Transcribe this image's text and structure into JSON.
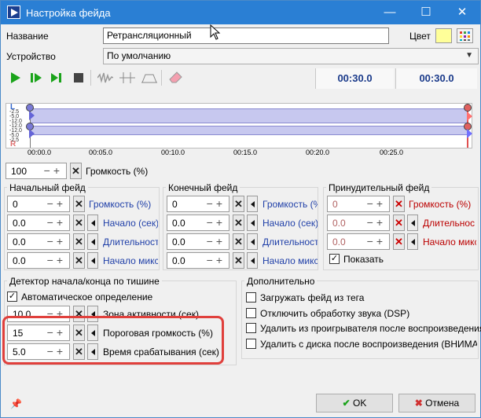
{
  "window": {
    "title": "Настройка фейда",
    "minimize": "—",
    "maximize": "☐",
    "close": "✕"
  },
  "name_label": "Название",
  "name_value": "Ретрансляционный",
  "color_label": "Цвет",
  "device_label": "Устройство",
  "device_value": "По умолчанию",
  "toolbar": {
    "icons": [
      "play-icon",
      "play-segment-icon",
      "play-to-end-icon",
      "stop-icon",
      "waveform-icon",
      "markers-icon",
      "envelope-icon",
      "eraser-icon"
    ],
    "time1": "00:30.0",
    "time2": "00:30.0"
  },
  "waveform": {
    "channel_left": "L",
    "channel_right": "R",
    "db_top": [
      "-2.5",
      "-5.0",
      "-12.0",
      "-12.0"
    ],
    "db_bottom": [
      "-12.0",
      "-5.0",
      "-2.5"
    ],
    "ruler": [
      "00:00.0",
      "00:05.0",
      "00:10.0",
      "00:15.0",
      "00:20.0",
      "00:25.0"
    ]
  },
  "volume": {
    "value": "100",
    "label": "Громкость (%)"
  },
  "fade_in": {
    "title": "Начальный фейд",
    "rows": [
      {
        "value": "0",
        "label": "Громкость (%)"
      },
      {
        "value": "0.0",
        "label": "Начало (сек)"
      },
      {
        "value": "0.0",
        "label": "Длительност"
      },
      {
        "value": "0.0",
        "label": "Начало микса"
      }
    ]
  },
  "fade_out": {
    "title": "Конечный фейд",
    "rows": [
      {
        "value": "0",
        "label": "Громкость (%)"
      },
      {
        "value": "0.0",
        "label": "Начало (сек)"
      },
      {
        "value": "0.0",
        "label": "Длительност"
      },
      {
        "value": "0.0",
        "label": "Начало микса"
      }
    ]
  },
  "forced_fade": {
    "title": "Принудительный фейд",
    "rows": [
      {
        "value": "0",
        "label": "Громкость (%)"
      },
      {
        "value": "0.0",
        "label": "Длительнос"
      },
      {
        "value": "0.0",
        "label": "Начало микса"
      }
    ],
    "show_label": "Показать"
  },
  "silence": {
    "title": "Детектор начала/конца по тишине",
    "auto_label": "Автоматическое определение",
    "rows": [
      {
        "value": "10.0",
        "label": "Зона активности (сек)"
      },
      {
        "value": "15",
        "label": "Пороговая громкость (%)"
      },
      {
        "value": "5.0",
        "label": "Время срабатывания (сек)"
      }
    ]
  },
  "extra": {
    "title": "Дополнительно",
    "options": [
      "Загружать фейд из тега",
      "Отключить обработку звука (DSP)",
      "Удалить из проигрывателя после воспроизведения",
      "Удалить с диска после воспроизведения (ВНИМАНИЕ!"
    ]
  },
  "buttons": {
    "ok": "OK",
    "cancel": "Отмена"
  },
  "colors": {
    "titlebar": "#2a7fd4",
    "highlight": "#e0403c",
    "band": "#c7c8ef",
    "time": "#1a3a8a"
  }
}
